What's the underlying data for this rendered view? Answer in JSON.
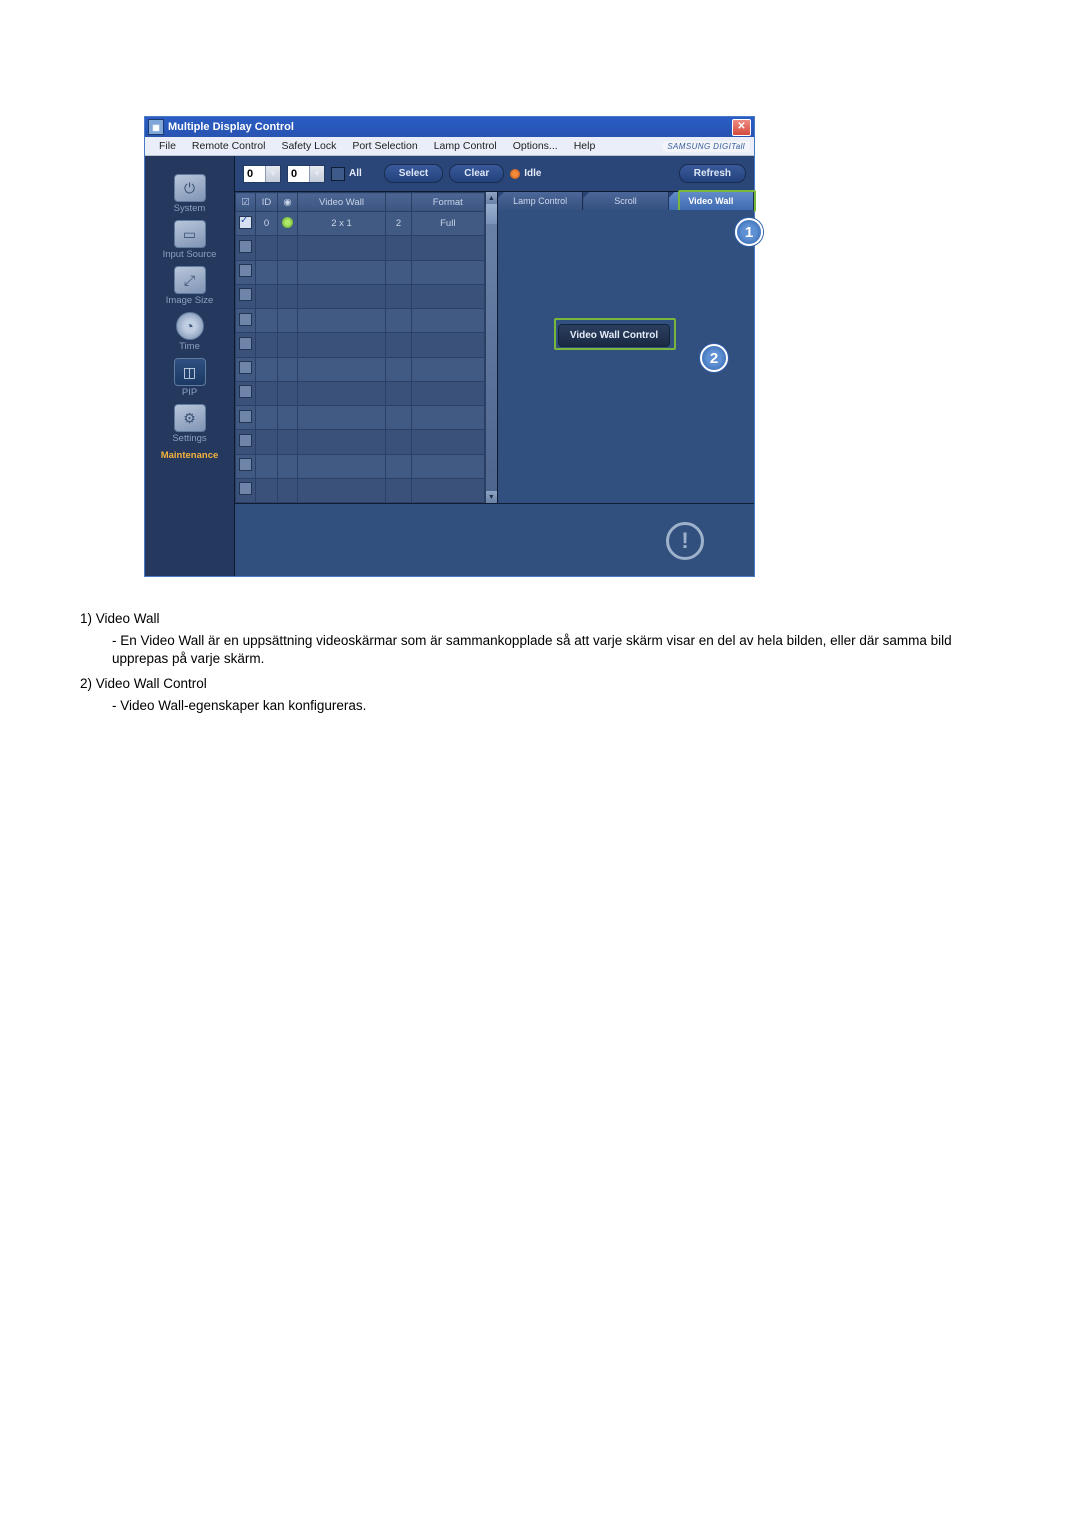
{
  "window": {
    "title": "Multiple Display Control",
    "brand": "SAMSUNG DIGITall"
  },
  "menu": {
    "items": [
      "File",
      "Remote Control",
      "Safety Lock",
      "Port Selection",
      "Lamp Control",
      "Options...",
      "Help"
    ]
  },
  "sidebar": {
    "items": [
      {
        "label": "System"
      },
      {
        "label": "Input Source"
      },
      {
        "label": "Image Size"
      },
      {
        "label": "Time"
      },
      {
        "label": "PIP"
      },
      {
        "label": "Settings"
      },
      {
        "label": "Maintenance"
      }
    ]
  },
  "toolbar": {
    "val1": "0",
    "val2": "0",
    "all": "All",
    "select": "Select",
    "clear": "Clear",
    "idle": "Idle",
    "refresh": "Refresh"
  },
  "table": {
    "headers": {
      "check": "☑",
      "id": "ID",
      "status": "◉",
      "videowall": "Video Wall",
      "div": "",
      "format": "Format"
    },
    "row0": {
      "id": "0",
      "videowall": "2 x 1",
      "div": "2",
      "format": "Full"
    }
  },
  "tabs": {
    "lamp": "Lamp Control",
    "scroll": "Scroll",
    "videowall": "Video Wall"
  },
  "panel": {
    "vw_control": "Video Wall Control"
  },
  "doc": {
    "item1_title": "1)  Video Wall",
    "item1_body": "- En Video Wall är en uppsättning videoskärmar som är sammankopplade så att varje skärm visar en del av hela bilden, eller där samma bild upprepas på varje skärm.",
    "item2_title": "2)  Video Wall Control",
    "item2_body": "- Video Wall-egenskaper kan konfigureras."
  },
  "callouts": {
    "c1": "1",
    "c2": "2"
  }
}
